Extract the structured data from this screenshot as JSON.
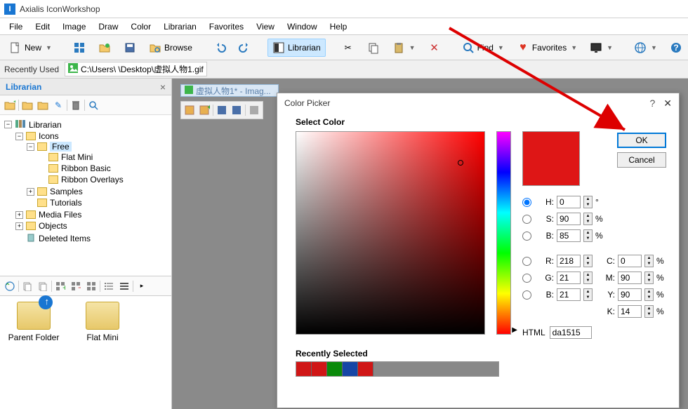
{
  "app": {
    "title": "Axialis IconWorkshop",
    "logo": "I"
  },
  "menu": [
    "File",
    "Edit",
    "Image",
    "Draw",
    "Color",
    "Librarian",
    "Favorites",
    "View",
    "Window",
    "Help"
  ],
  "toolbar": {
    "new": "New",
    "browse": "Browse",
    "librarian": "Librarian",
    "find": "Find",
    "favorites": "Favorites"
  },
  "recent": {
    "label": "Recently Used",
    "path": "C:\\Users\\                \\Desktop\\虚拟人物1.gif"
  },
  "sidebar": {
    "title": "Librarian",
    "tree": {
      "root": "Librarian",
      "icons": "Icons",
      "free": "Free",
      "flatmini": "Flat Mini",
      "ribbonbasic": "Ribbon Basic",
      "ribbonoverlays": "Ribbon Overlays",
      "samples": "Samples",
      "tutorials": "Tutorials",
      "mediafiles": "Media Files",
      "objects": "Objects",
      "deleted": "Deleted Items"
    },
    "folders": {
      "parent": "Parent Folder",
      "flatmini": "Flat Mini"
    }
  },
  "doc": {
    "title": "虚拟人物1* - Imag..."
  },
  "dialog": {
    "title": "Color Picker",
    "select": "Select Color",
    "ok": "OK",
    "cancel": "Cancel",
    "h_label": "H:",
    "h_val": "0",
    "h_unit": "°",
    "s_label": "S:",
    "s_val": "90",
    "s_unit": "%",
    "bri_label": "B:",
    "bri_val": "85",
    "bri_unit": "%",
    "r_label": "R:",
    "r_val": "218",
    "g_label": "G:",
    "g_val": "21",
    "b_label": "B:",
    "b_val": "21",
    "c_label": "C:",
    "c_val": "0",
    "c_unit": "%",
    "m_label": "M:",
    "m_val": "90",
    "m_unit": "%",
    "y_label": "Y:",
    "y_val": "90",
    "y_unit": "%",
    "k_label": "K:",
    "k_val": "14",
    "k_unit": "%",
    "html_label": "HTML",
    "html_val": "da1515",
    "recent": "Recently Selected",
    "swatches": [
      "#d01616",
      "#d01616",
      "#0a8a0a",
      "#1646a6",
      "#d01616"
    ]
  }
}
